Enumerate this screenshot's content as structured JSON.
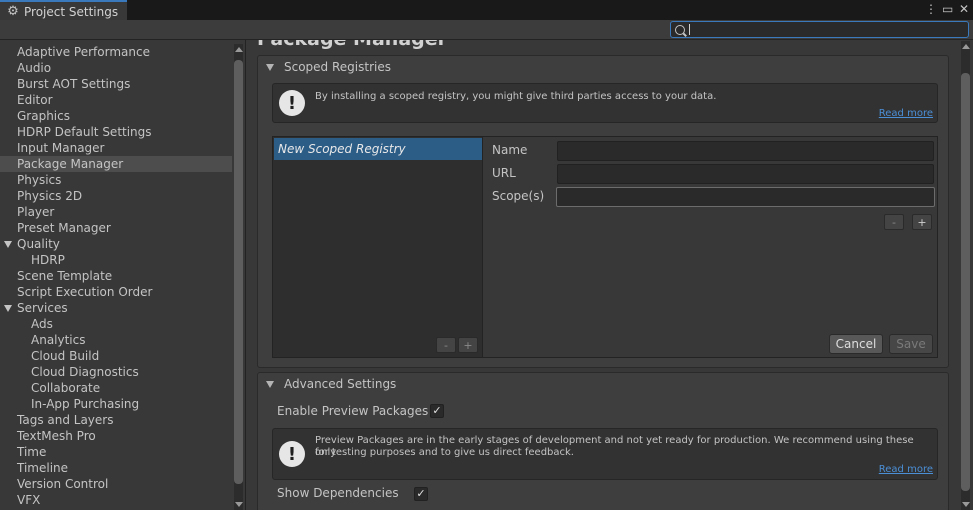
{
  "window": {
    "tab_title": "Project Settings",
    "controls": [
      "more-icon",
      "maximize-icon",
      "close-icon"
    ]
  },
  "search": {
    "value": "",
    "placeholder": ""
  },
  "sidebar": {
    "items": [
      {
        "label": "Adaptive Performance",
        "indent": 0
      },
      {
        "label": "Audio",
        "indent": 0
      },
      {
        "label": "Burst AOT Settings",
        "indent": 0
      },
      {
        "label": "Editor",
        "indent": 0
      },
      {
        "label": "Graphics",
        "indent": 0
      },
      {
        "label": "HDRP Default Settings",
        "indent": 0
      },
      {
        "label": "Input Manager",
        "indent": 0
      },
      {
        "label": "Package Manager",
        "indent": 0,
        "selected": true
      },
      {
        "label": "Physics",
        "indent": 0
      },
      {
        "label": "Physics 2D",
        "indent": 0
      },
      {
        "label": "Player",
        "indent": 0
      },
      {
        "label": "Preset Manager",
        "indent": 0
      },
      {
        "label": "Quality",
        "indent": 0,
        "expanded": true
      },
      {
        "label": "HDRP",
        "indent": 1
      },
      {
        "label": "Scene Template",
        "indent": 0
      },
      {
        "label": "Script Execution Order",
        "indent": 0
      },
      {
        "label": "Services",
        "indent": 0,
        "expanded": true
      },
      {
        "label": "Ads",
        "indent": 1
      },
      {
        "label": "Analytics",
        "indent": 1
      },
      {
        "label": "Cloud Build",
        "indent": 1
      },
      {
        "label": "Cloud Diagnostics",
        "indent": 1
      },
      {
        "label": "Collaborate",
        "indent": 1
      },
      {
        "label": "In-App Purchasing",
        "indent": 1
      },
      {
        "label": "Tags and Layers",
        "indent": 0
      },
      {
        "label": "TextMesh Pro",
        "indent": 0
      },
      {
        "label": "Time",
        "indent": 0
      },
      {
        "label": "Timeline",
        "indent": 0
      },
      {
        "label": "Version Control",
        "indent": 0
      },
      {
        "label": "VFX",
        "indent": 0
      }
    ]
  },
  "main": {
    "page_title": "Package Manager",
    "scoped": {
      "header": "Scoped Registries",
      "help_text": "By installing a scoped registry, you might give third parties access to your data.",
      "read_more": "Read more",
      "registry_item": "New Scoped Registry",
      "list_remove": "-",
      "list_add": "+",
      "name_label": "Name",
      "url_label": "URL",
      "scopes_label": "Scope(s)",
      "scope_remove": "-",
      "scope_add": "+",
      "cancel_label": "Cancel",
      "save_label": "Save"
    },
    "advanced": {
      "header": "Advanced Settings",
      "preview_label": "Enable Preview Packages",
      "preview_checked": "✓",
      "help_text_1": "Preview Packages are in the early stages of development and not yet ready for production. We recommend using these only",
      "help_text_2": "for testing purposes and to give us direct feedback.",
      "read_more": "Read more",
      "deps_label": "Show Dependencies",
      "deps_checked": "✓"
    }
  },
  "colors": {
    "accent": "#3a79bb",
    "selection": "#2c5d87",
    "link": "#4b8fd6"
  }
}
